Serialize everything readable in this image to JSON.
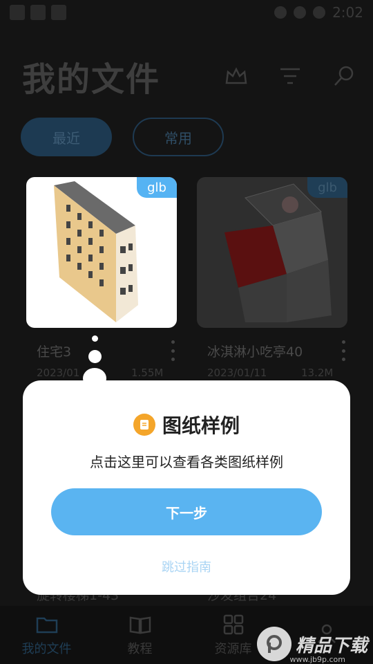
{
  "status_bar": {
    "time": "2:02"
  },
  "header": {
    "title": "我的文件"
  },
  "tabs": [
    {
      "label": "最近"
    },
    {
      "label": "常用"
    }
  ],
  "files": [
    {
      "name": "住宅3",
      "date": "2023/01",
      "size": "1.55M",
      "badge": "glb"
    },
    {
      "name": "冰淇淋小吃亭40",
      "date": "2023/01/11",
      "size": "13.2M",
      "badge": "glb"
    }
  ],
  "files_row2": [
    {
      "name": "旋转楼梯1-43"
    },
    {
      "name": "沙发组合24"
    }
  ],
  "dialog": {
    "title": "图纸样例",
    "text": "点击这里可以查看各类图纸样例",
    "next_label": "下一步",
    "skip_label": "跳过指南"
  },
  "bottom_nav": [
    {
      "label": "我的文件"
    },
    {
      "label": "教程"
    },
    {
      "label": "资源库"
    },
    {
      "label": ""
    }
  ],
  "watermark": {
    "text": "精品下载",
    "url": "www.jb9p.com"
  },
  "colors": {
    "accent": "#5ab4f1",
    "icon": "#f4a52a"
  }
}
